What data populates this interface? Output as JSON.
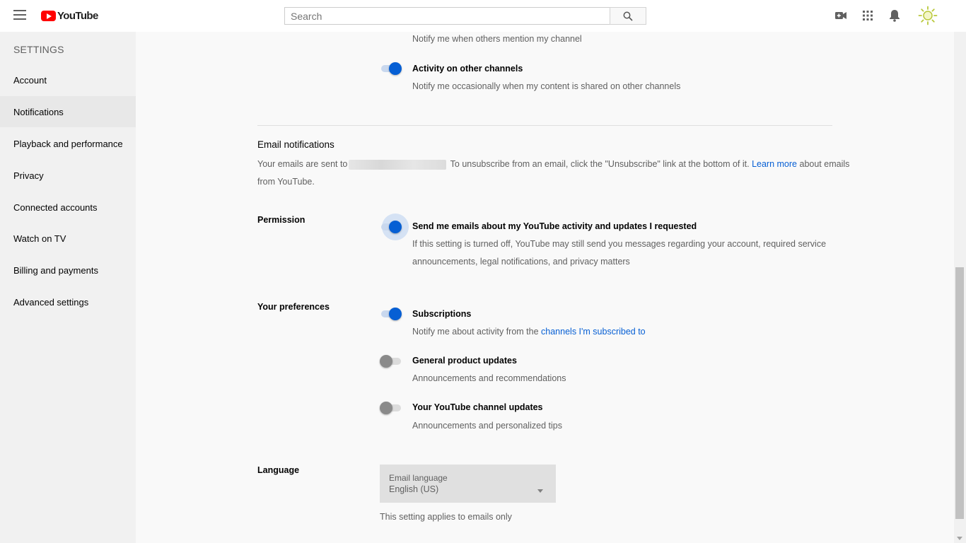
{
  "header": {
    "logo_text": "YouTube",
    "search_placeholder": "Search",
    "colors": {
      "brand": "#ff0000",
      "accent": "#065fd4"
    }
  },
  "sidebar": {
    "title": "SETTINGS",
    "items": [
      {
        "label": "Account"
      },
      {
        "label": "Notifications",
        "active": true
      },
      {
        "label": "Playback and performance"
      },
      {
        "label": "Privacy"
      },
      {
        "label": "Connected accounts"
      },
      {
        "label": "Watch on TV"
      },
      {
        "label": "Billing and payments"
      },
      {
        "label": "Advanced settings"
      }
    ]
  },
  "channel_notifications": {
    "mentions_desc": "Notify me when others mention my channel",
    "activity_title": "Activity on other channels",
    "activity_desc": "Notify me occasionally when my content is shared on other channels",
    "activity_on": true
  },
  "email": {
    "title": "Email notifications",
    "info_prefix": "Your emails are sent to",
    "info_middle": "To unsubscribe from an email, click the \"Unsubscribe\" link at the bottom of it.",
    "learn_more": "Learn more",
    "info_suffix": "about emails",
    "info_line2": "from YouTube.",
    "permission_label": "Permission",
    "permission_title": "Send me emails about my YouTube activity and updates I requested",
    "permission_desc_1": "If this setting is turned off, YouTube may still send you messages regarding your account, required service",
    "permission_desc_2": "announcements, legal notifications, and privacy matters",
    "permission_on": true,
    "preferences_label": "Your preferences",
    "subscriptions_title": "Subscriptions",
    "subscriptions_desc": "Notify me about activity from the",
    "subscriptions_link": "channels I'm subscribed to",
    "subscriptions_on": true,
    "product_title": "General product updates",
    "product_desc": "Announcements and recommendations",
    "product_on": false,
    "channel_title": "Your YouTube channel updates",
    "channel_desc": "Announcements and personalized tips",
    "channel_on": false,
    "language_label": "Language",
    "language_field_label": "Email language",
    "language_value": "English (US)",
    "language_note": "This setting applies to emails only"
  },
  "icons": [
    "menu-icon",
    "youtube-logo-icon",
    "search-icon",
    "video-camera-icon",
    "apps-grid-icon",
    "bell-icon",
    "avatar-sun-icon"
  ]
}
